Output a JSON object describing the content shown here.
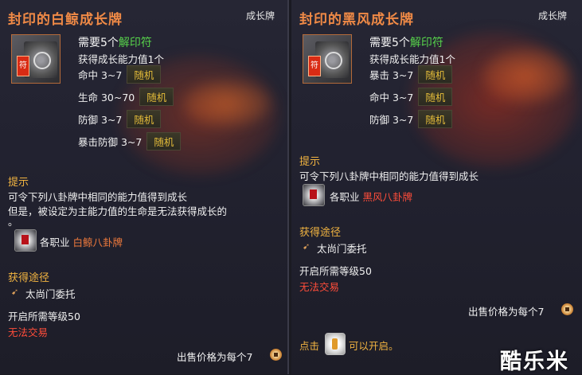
{
  "left": {
    "title": "封印的白鲸成长牌",
    "type": "成长牌",
    "req_prefix": "需要5个",
    "req_item": "解印符",
    "gain": "获得成长能力值1个",
    "stats": [
      {
        "label": "命中 3~7",
        "tag": "随机"
      },
      {
        "label": "生命 30~70",
        "tag": "随机"
      },
      {
        "label": "防御 3~7",
        "tag": "随机"
      },
      {
        "label": "暴击防御 3~7",
        "tag": "随机"
      }
    ],
    "hint_header": "提示",
    "hint_lines": [
      "可令下列八卦牌中相同的能力值得到成长",
      "但是，被设定为主能力值的生命是无法获得成长的",
      "。"
    ],
    "class_label": "各职业",
    "class_item": "白鲸八卦牌",
    "source_header": "获得途径",
    "source_item": "太尚门委托",
    "level_req": "开启所需等级50",
    "trade": "无法交易",
    "sell": "出售价格为每个7"
  },
  "right": {
    "title": "封印的黑风成长牌",
    "type": "成长牌",
    "req_prefix": "需要5个",
    "req_item": "解印符",
    "gain": "获得成长能力值1个",
    "stats": [
      {
        "label": "暴击 3~7",
        "tag": "随机"
      },
      {
        "label": "命中 3~7",
        "tag": "随机"
      },
      {
        "label": "防御 3~7",
        "tag": "随机"
      }
    ],
    "hint_header": "提示",
    "hint_lines": [
      "可令下列八卦牌中相同的能力值得到成长"
    ],
    "class_label": "各职业",
    "class_item": "黑风八卦牌",
    "source_header": "获得途径",
    "source_item": "太尚门委托",
    "level_req": "开启所需等级50",
    "trade": "无法交易",
    "sell": "出售价格为每个7",
    "click_prefix": "点击",
    "click_suffix": "可以开启。"
  },
  "seal_char": "符",
  "watermark": "酷乐米",
  "colors": {
    "title": "#f08a46",
    "green": "#57d34b",
    "section": "#f2b441",
    "random": "#e3bb39",
    "red": "#ff4d3a"
  }
}
